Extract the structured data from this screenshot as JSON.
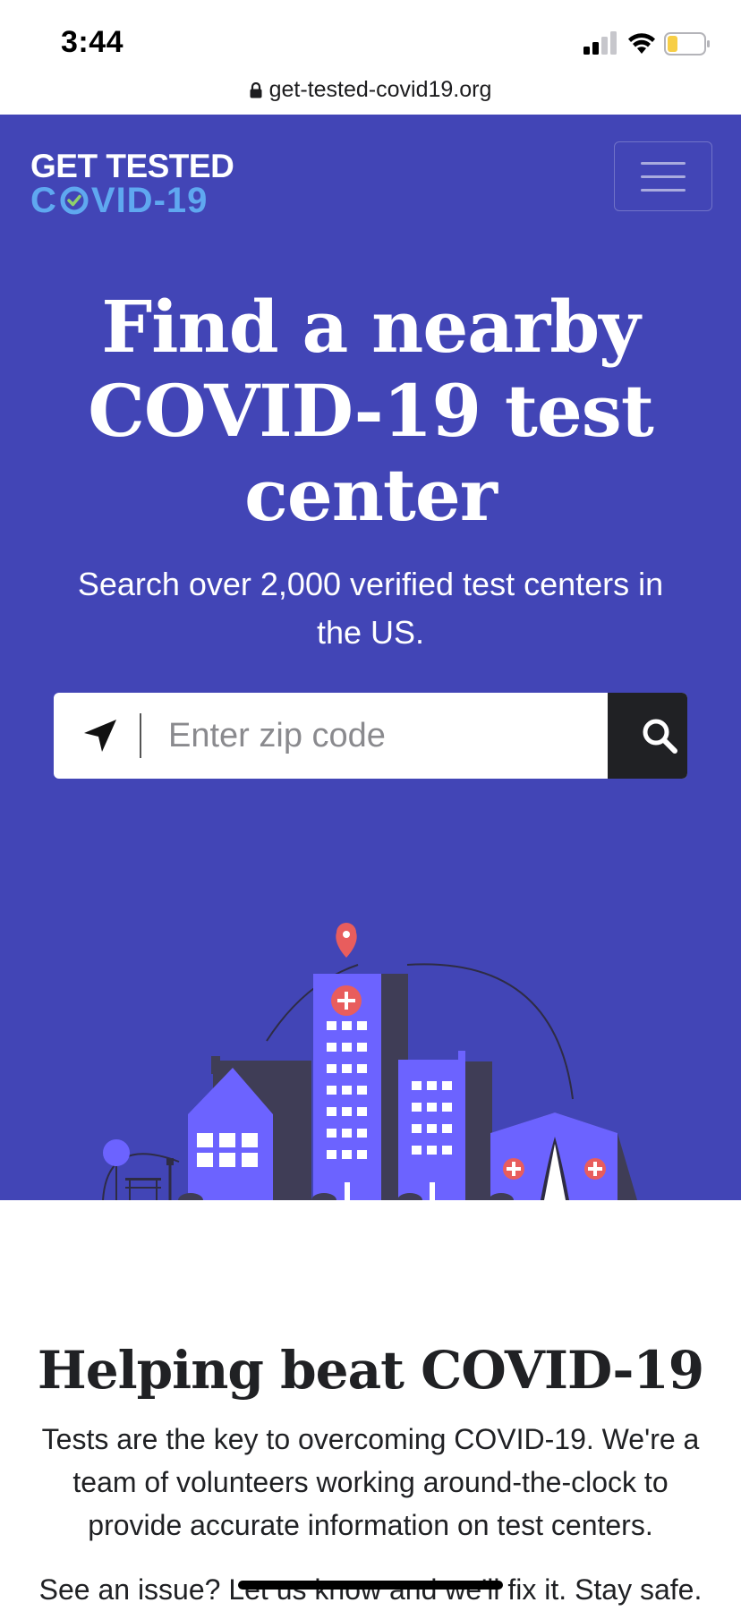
{
  "status_bar": {
    "time": "3:44"
  },
  "url_bar": {
    "url": "get-tested-covid19.org"
  },
  "logo": {
    "line1": "GET TESTED",
    "line2_before": "C",
    "line2_after": "VID-19"
  },
  "hero": {
    "title": "Find a nearby COVID-19 test center",
    "subtitle": "Search over 2,000 verified test centers in the US."
  },
  "search": {
    "placeholder": "Enter zip code",
    "value": ""
  },
  "about": {
    "title": "Helping beat COVID-19",
    "text": "Tests are the key to overcoming COVID-19. We're a team of volunteers working around-the-clock to provide accurate information on test centers.",
    "issue_prefix": "See an issue? ",
    "issue_link": "Let us know",
    "issue_suffix": " and we'll fix it. Stay safe."
  },
  "colors": {
    "hero_bg": "#4245b6",
    "building_light": "#6c63ff",
    "building_dark": "#3f3d56",
    "pin_red": "#e85d5d",
    "logo_blue": "#5fa8f0",
    "search_button": "#202124"
  },
  "icons": {
    "lock": "lock-icon",
    "locate": "location-arrow-icon",
    "search": "search-icon",
    "menu": "hamburger-menu-icon",
    "check": "check-icon"
  }
}
